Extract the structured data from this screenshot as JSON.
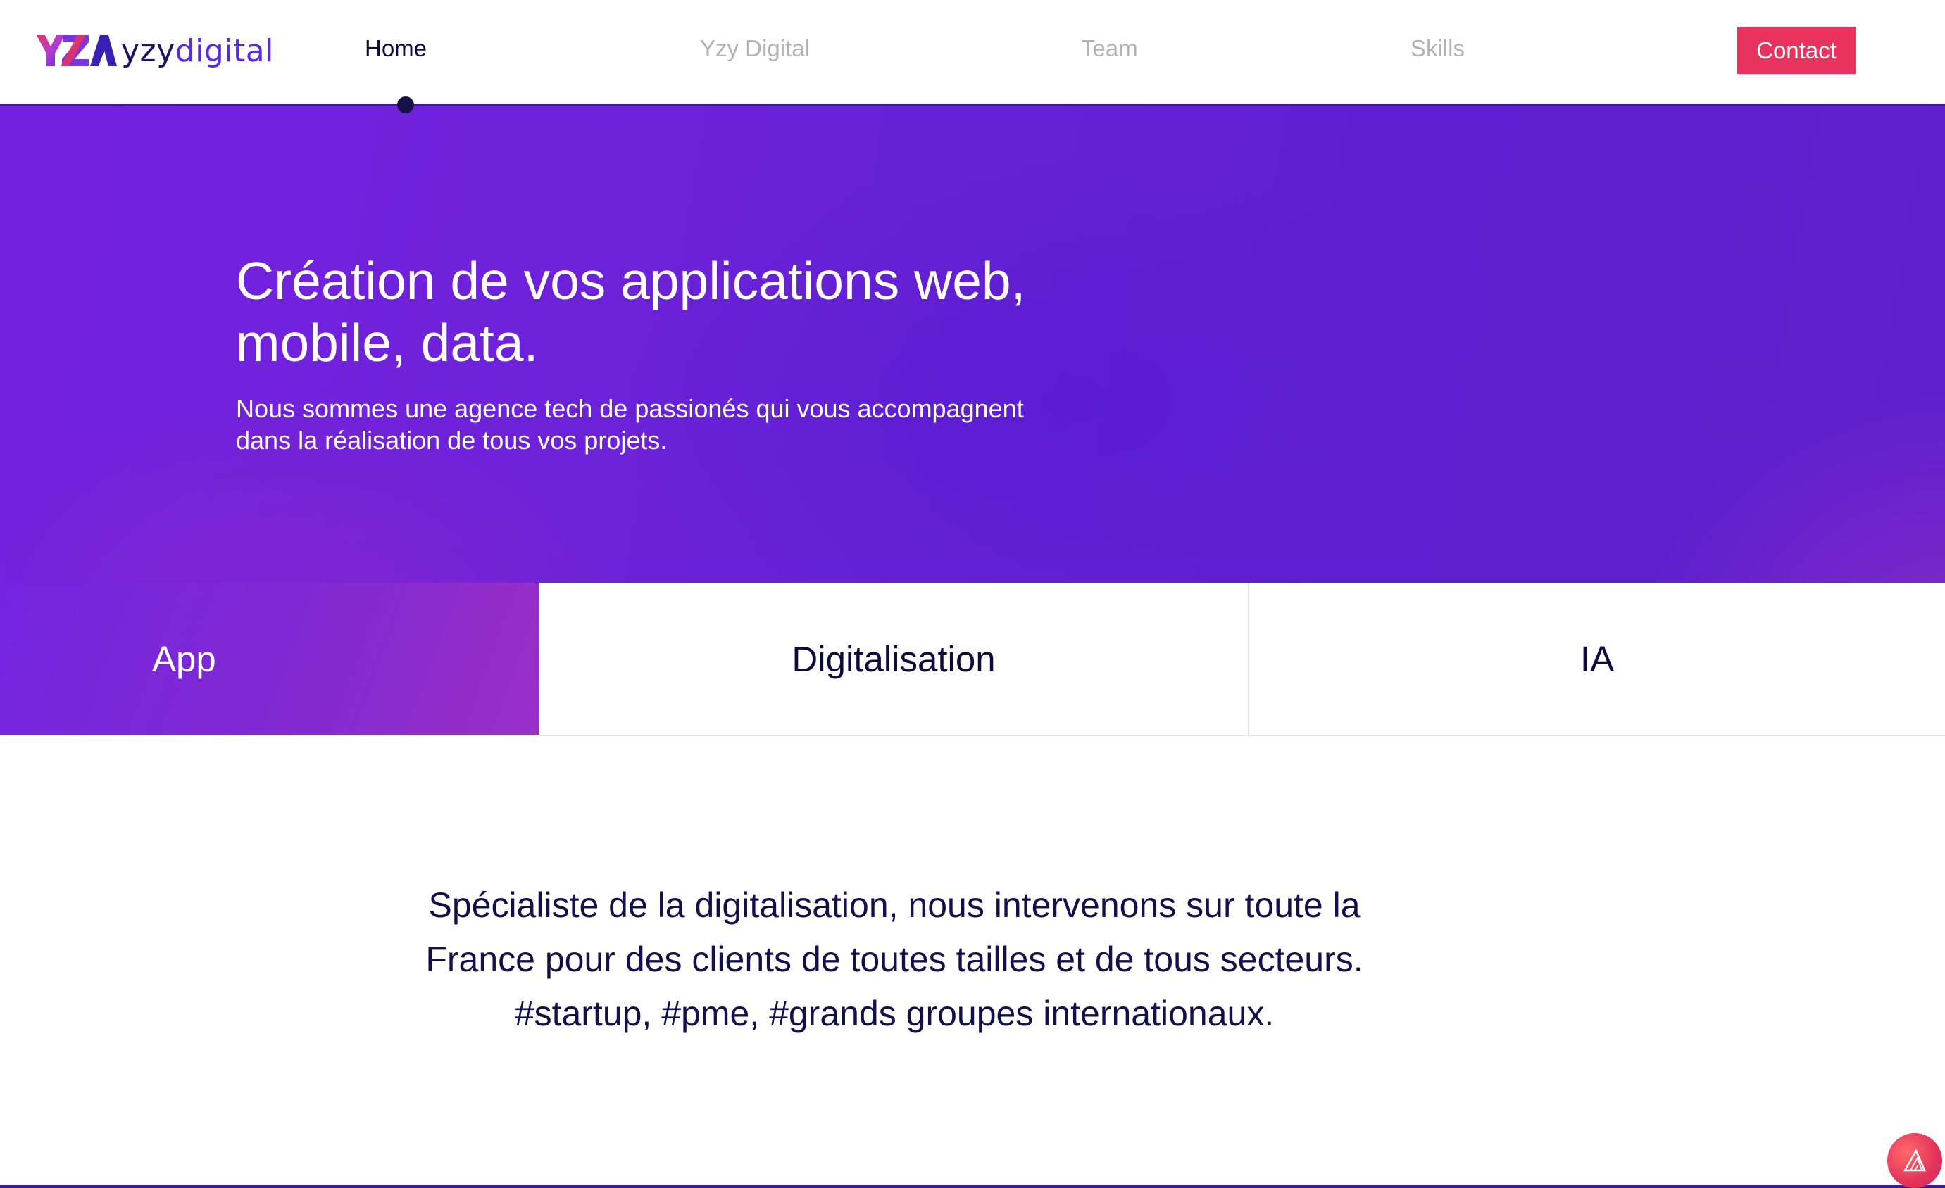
{
  "brand": {
    "name_part1": "yzy",
    "name_part2": "digital",
    "logo_icon": "yza-logo-icon",
    "colors": {
      "primary": "#5a2be0",
      "dark": "#1c1463",
      "accent": "#e8335f"
    }
  },
  "nav": {
    "items": [
      {
        "label": "Home",
        "active": true
      },
      {
        "label": "Yzy Digital",
        "active": false
      },
      {
        "label": "Team",
        "active": false
      },
      {
        "label": "Skills",
        "active": false
      }
    ],
    "contact_label": "Contact"
  },
  "hero": {
    "title_line1": "Création de vos applications web,",
    "title_line2": "mobile, data.",
    "subtitle_line1": "Nous sommes une agence tech de passionés qui vous accompagnent",
    "subtitle_line2": "dans la réalisation de tous vos projets."
  },
  "tabs": [
    {
      "label": "App",
      "active": true
    },
    {
      "label": "Digitalisation",
      "active": false
    },
    {
      "label": "IA",
      "active": false
    }
  ],
  "intro": {
    "line1": "Spécialiste de la digitalisation, nous intervenons sur toute la",
    "line2": "France pour des clients de toutes tailles et de tous secteurs.",
    "line3": "#startup, #pme, #grands groupes internationaux."
  },
  "fab": {
    "icon": "triangle-logo-icon"
  }
}
